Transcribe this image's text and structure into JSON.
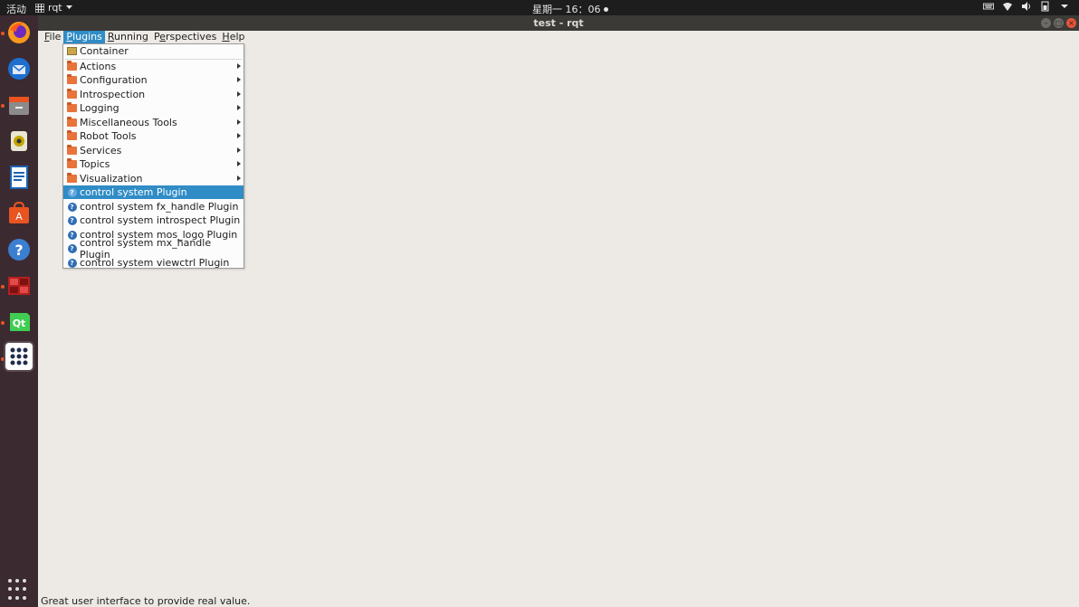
{
  "topbar": {
    "activities": "活动",
    "app_name": "rqt",
    "clock": "星期一 16：06"
  },
  "window": {
    "title": "test - rqt"
  },
  "menubar": [
    {
      "prefix": "",
      "mnemonic": "F",
      "rest": "ile",
      "open": false
    },
    {
      "prefix": "",
      "mnemonic": "P",
      "rest": "lugins",
      "open": true
    },
    {
      "prefix": "",
      "mnemonic": "R",
      "rest": "unning",
      "open": false
    },
    {
      "prefix": "P",
      "mnemonic": "e",
      "rest": "rspectives",
      "open": false
    },
    {
      "prefix": "",
      "mnemonic": "H",
      "rest": "elp",
      "open": false
    }
  ],
  "plugins_menu": {
    "container": {
      "label": "Container",
      "icon": "container-icon"
    },
    "categories": [
      {
        "label": "Actions",
        "icon": "folder-icon"
      },
      {
        "label": "Configuration",
        "icon": "folder-icon"
      },
      {
        "label": "Introspection",
        "icon": "folder-icon"
      },
      {
        "label": "Logging",
        "icon": "folder-icon"
      },
      {
        "label": "Miscellaneous Tools",
        "icon": "folder-icon"
      },
      {
        "label": "Robot Tools",
        "icon": "folder-icon"
      },
      {
        "label": "Services",
        "icon": "folder-icon"
      },
      {
        "label": "Topics",
        "icon": "folder-icon"
      },
      {
        "label": "Visualization",
        "icon": "folder-icon"
      }
    ],
    "plugins": [
      {
        "label": "control system Plugin",
        "icon": "help-icon",
        "selected": true
      },
      {
        "label": "control system fx_handle Plugin",
        "icon": "help-icon",
        "selected": false
      },
      {
        "label": "control system introspect Plugin",
        "icon": "help-icon",
        "selected": false
      },
      {
        "label": "control system mos_logo Plugin",
        "icon": "help-icon",
        "selected": false
      },
      {
        "label": "control system mx_handle Plugin",
        "icon": "help-icon",
        "selected": false
      },
      {
        "label": "control system viewctrl Plugin",
        "icon": "help-icon",
        "selected": false
      }
    ]
  },
  "statusbar": {
    "text": "Great user interface to provide real value."
  },
  "dock": [
    {
      "name": "firefox-icon",
      "running": true
    },
    {
      "name": "thunderbird-icon",
      "running": false
    },
    {
      "name": "files-icon",
      "running": true
    },
    {
      "name": "rhythmbox-icon",
      "running": false
    },
    {
      "name": "writer-icon",
      "running": false
    },
    {
      "name": "software-center-icon",
      "running": false
    },
    {
      "name": "help-icon",
      "running": false
    },
    {
      "name": "terminal-app-icon",
      "running": true
    },
    {
      "name": "qt-creator-icon",
      "running": true
    },
    {
      "name": "rqt-app-icon",
      "running": true
    }
  ],
  "colors": {
    "selection": "#308cc6",
    "dock": "#3c2a31",
    "window_bg": "#edeae5"
  }
}
